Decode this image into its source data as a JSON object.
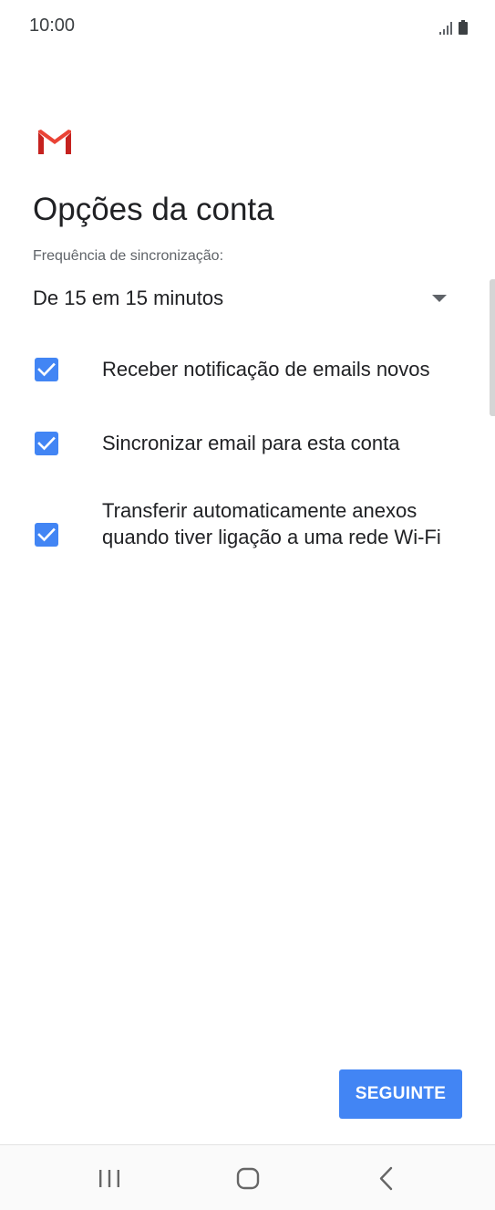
{
  "status_bar": {
    "time": "10:00",
    "icons": [
      "signal-icon",
      "battery-icon"
    ]
  },
  "app": {
    "logo": "gmail-logo"
  },
  "page": {
    "title": "Opções da conta"
  },
  "sync": {
    "label": "Frequência de sincronização:",
    "selected_value": "De 15 em 15 minutos"
  },
  "options": [
    {
      "label": "Receber notificação de emails novos",
      "checked": true
    },
    {
      "label": "Sincronizar email para esta conta",
      "checked": true
    },
    {
      "label": "Transferir automaticamente anexos quando tiver ligação a uma rede Wi-Fi",
      "checked": true
    }
  ],
  "actions": {
    "next_label": "SEGUINTE"
  },
  "nav": {
    "icons": [
      "recents-icon",
      "home-icon",
      "back-icon"
    ]
  },
  "colors": {
    "accent": "#4285f4",
    "gmail_red": "#d93025",
    "text_primary": "#202124",
    "text_secondary": "#5f6368"
  }
}
